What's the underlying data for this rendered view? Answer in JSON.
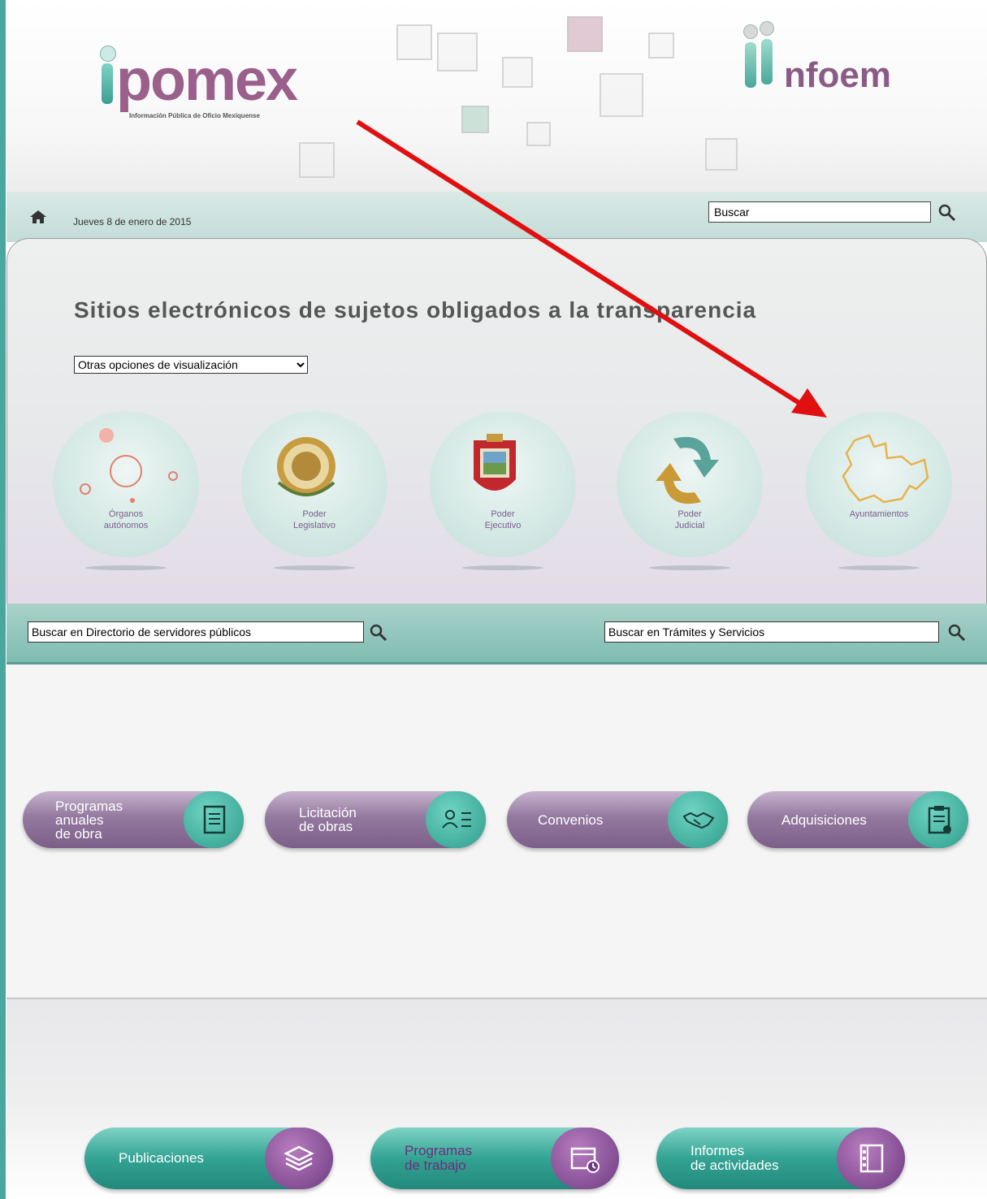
{
  "header": {
    "logo_left_text": "pomex",
    "logo_left_subtitle": "Información Pública de Oficio Mexiquense",
    "logo_right_text": "nfoem"
  },
  "navbar": {
    "date": "Jueves 8 de enero de 2015",
    "search_value": "Buscar"
  },
  "main": {
    "title": "Sitios electrónicos de sujetos obligados a la transparencia",
    "view_select": {
      "selected": "Otras opciones de visualización"
    },
    "categories": [
      {
        "label_line1": "Órganos",
        "label_line2": "autónomos",
        "icon": "circles-icon"
      },
      {
        "label_line1": "Poder",
        "label_line2": "Legislativo",
        "icon": "legislative-seal-icon"
      },
      {
        "label_line1": "Poder",
        "label_line2": "Ejecutivo",
        "icon": "state-shield-icon"
      },
      {
        "label_line1": "Poder",
        "label_line2": "Judicial",
        "icon": "judicial-arrows-icon"
      },
      {
        "label_line1": "Ayuntamientos",
        "label_line2": "",
        "icon": "state-map-icon"
      }
    ]
  },
  "directory_bar": {
    "directory_search_value": "Buscar en Directorio de servidores públicos",
    "tramites_search_value": "Buscar en Trámites y Servicios"
  },
  "obras_buttons": [
    {
      "line1": "Programas",
      "line2": "anuales",
      "line3": "de obra",
      "icon": "document-icon"
    },
    {
      "line1": "Licitación",
      "line2": "de obras",
      "line3": "",
      "icon": "people-list-icon"
    },
    {
      "line1": "Convenios",
      "line2": "",
      "line3": "",
      "icon": "handshake-icon"
    },
    {
      "line1": "Adquisiciones",
      "line2": "",
      "line3": "",
      "icon": "clipboard-icon"
    }
  ],
  "bottom_buttons": [
    {
      "line1": "Publicaciones",
      "line2": "",
      "icon": "layers-icon"
    },
    {
      "line1": "Programas",
      "line2": "de trabajo",
      "icon": "calendar-clock-icon"
    },
    {
      "line1": "Informes",
      "line2": "de actividades",
      "icon": "notebook-icon"
    }
  ],
  "colors": {
    "accent_teal": "#33a393",
    "accent_purple": "#7b5f88",
    "annotation_arrow": "#e01010"
  }
}
